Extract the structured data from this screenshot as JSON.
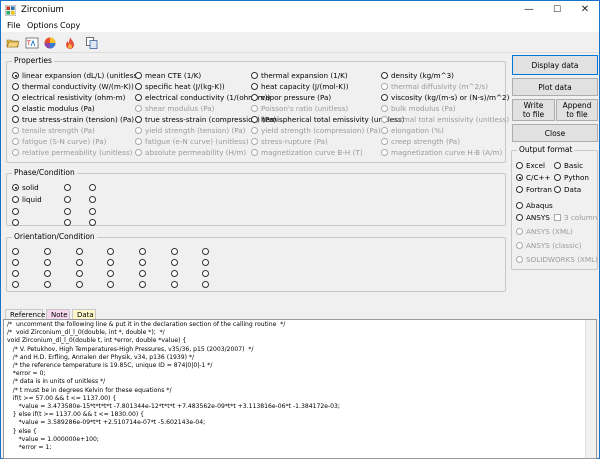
{
  "window": {
    "title": "Zirconium",
    "min": "—",
    "max": "☐",
    "close": "✕"
  },
  "menu": [
    "File",
    "Options",
    "Copy"
  ],
  "properties": {
    "title": "Properties",
    "items": [
      {
        "label": "linear expansion (dL/L) (unitless)",
        "enabled": true,
        "selected": true
      },
      {
        "label": "mean CTE (1/K)",
        "enabled": true
      },
      {
        "label": "thermal expansion (1/K)",
        "enabled": true
      },
      {
        "label": "density (kg/m^3)",
        "enabled": true
      },
      {
        "label": "thermal conductivity (W/(m-K))",
        "enabled": true
      },
      {
        "label": "specific heat (J/(kg-K))",
        "enabled": true
      },
      {
        "label": "heat capacity (J/(mol-K))",
        "enabled": true
      },
      {
        "label": "thermal diffusivity (m^2/s)",
        "enabled": false
      },
      {
        "label": "electrical resistivity (ohm-m)",
        "enabled": true
      },
      {
        "label": "electrical conductivity (1/(ohm-m))",
        "enabled": true
      },
      {
        "label": "vapor pressure (Pa)",
        "enabled": true
      },
      {
        "label": "viscosity (kg/(m-s) or (N-s)/m^2)",
        "enabled": true
      },
      {
        "label": "elastic modulus (Pa)",
        "enabled": true
      },
      {
        "label": "shear modulus (Pa)",
        "enabled": false
      },
      {
        "label": "Poisson's ratio (unitless)",
        "enabled": false
      },
      {
        "label": "bulk modulus (Pa)",
        "enabled": false
      },
      {
        "label": "true stress-strain (tension) (Pa)",
        "enabled": true
      },
      {
        "label": "true stress-strain (compression) (Pa)",
        "enabled": true
      },
      {
        "label": "hemispherical total emissivity (unitless)",
        "enabled": true
      },
      {
        "label": "normal total emissivity (unitless)",
        "enabled": false
      },
      {
        "label": "tensile strength (Pa)",
        "enabled": false
      },
      {
        "label": "yield strength (tension) (Pa)",
        "enabled": false
      },
      {
        "label": "yield strength (compression) (Pa)",
        "enabled": false
      },
      {
        "label": "elongation (%)",
        "enabled": false
      },
      {
        "label": "fatigue (S-N curve) (Pa)",
        "enabled": false
      },
      {
        "label": "fatigue (e-N curve) (unitless)",
        "enabled": false
      },
      {
        "label": "stress-rupture (Pa)",
        "enabled": false
      },
      {
        "label": "creep strength (Pa)",
        "enabled": false
      },
      {
        "label": "relative permeability (unitless)",
        "enabled": false
      },
      {
        "label": "absolute permeability (H/m)",
        "enabled": false
      },
      {
        "label": "magnetization curve B-H (T)",
        "enabled": false
      },
      {
        "label": "magnetization curve H-B (A/m)",
        "enabled": false
      }
    ]
  },
  "phase": {
    "title": "Phase/Condition",
    "solid": "solid",
    "liquid": "liquid"
  },
  "orientation": {
    "title": "Orientation/Condition"
  },
  "buttons": {
    "display": "Display data",
    "plot": "Plot data",
    "write_l1": "Write",
    "write_l2": "to file",
    "append_l1": "Append",
    "append_l2": "to file",
    "close": "Close"
  },
  "output": {
    "title": "Output format",
    "excel": "Excel",
    "basic": "Basic",
    "c": "C/C++",
    "python": "Python",
    "fortran": "Fortran",
    "data": "Data",
    "abaqus": "Abaqus",
    "ansys": "ANSYS",
    "column": "3 column",
    "ansys_xml": "ANSYS (XML)",
    "ansys_classic": "ANSYS (classic)",
    "solidworks": "SOLIDWORKS (XML)"
  },
  "tabs": [
    "Reference",
    "Note",
    "Data"
  ],
  "code": "/*  uncomment the following line & put it in the declaration section of the calling routine  */\n/*  void Zirconium_dl_l_0(double, int *, double *);  */\nvoid Zirconium_dl_l_0(double t, int *error, double *value) {\n   /* V. Petukhov, High Temperatures-High Pressures, v35/36, p15 (2003/2007)  */\n   /* and H.D. Erfling, Annalen der Physik, v34, p136 (1939) */\n   /* the reference temperature is 19.85C, unique ID = 874|0|0|-1 */\n   *error = 0;\n   /* data is in units of unitless */\n   /* t must be in degrees Kelvin for these equations */\n   if(t >= 57.00 && t <= 1137.00) {\n      *value = 3.473580e-15*t*t*t*t -7.801344e-12*t*t*t +7.483562e-09*t*t +3.113816e-06*t -1.384172e-03;\n   } else if(t >= 1137.00 && t <= 1830.00) {\n      *value = 3.589286e-09*t*t +2.510714e-07*t -5.602143e-04;\n   } else {\n      *value = 1.000000e+100;\n      *error = 1;"
}
